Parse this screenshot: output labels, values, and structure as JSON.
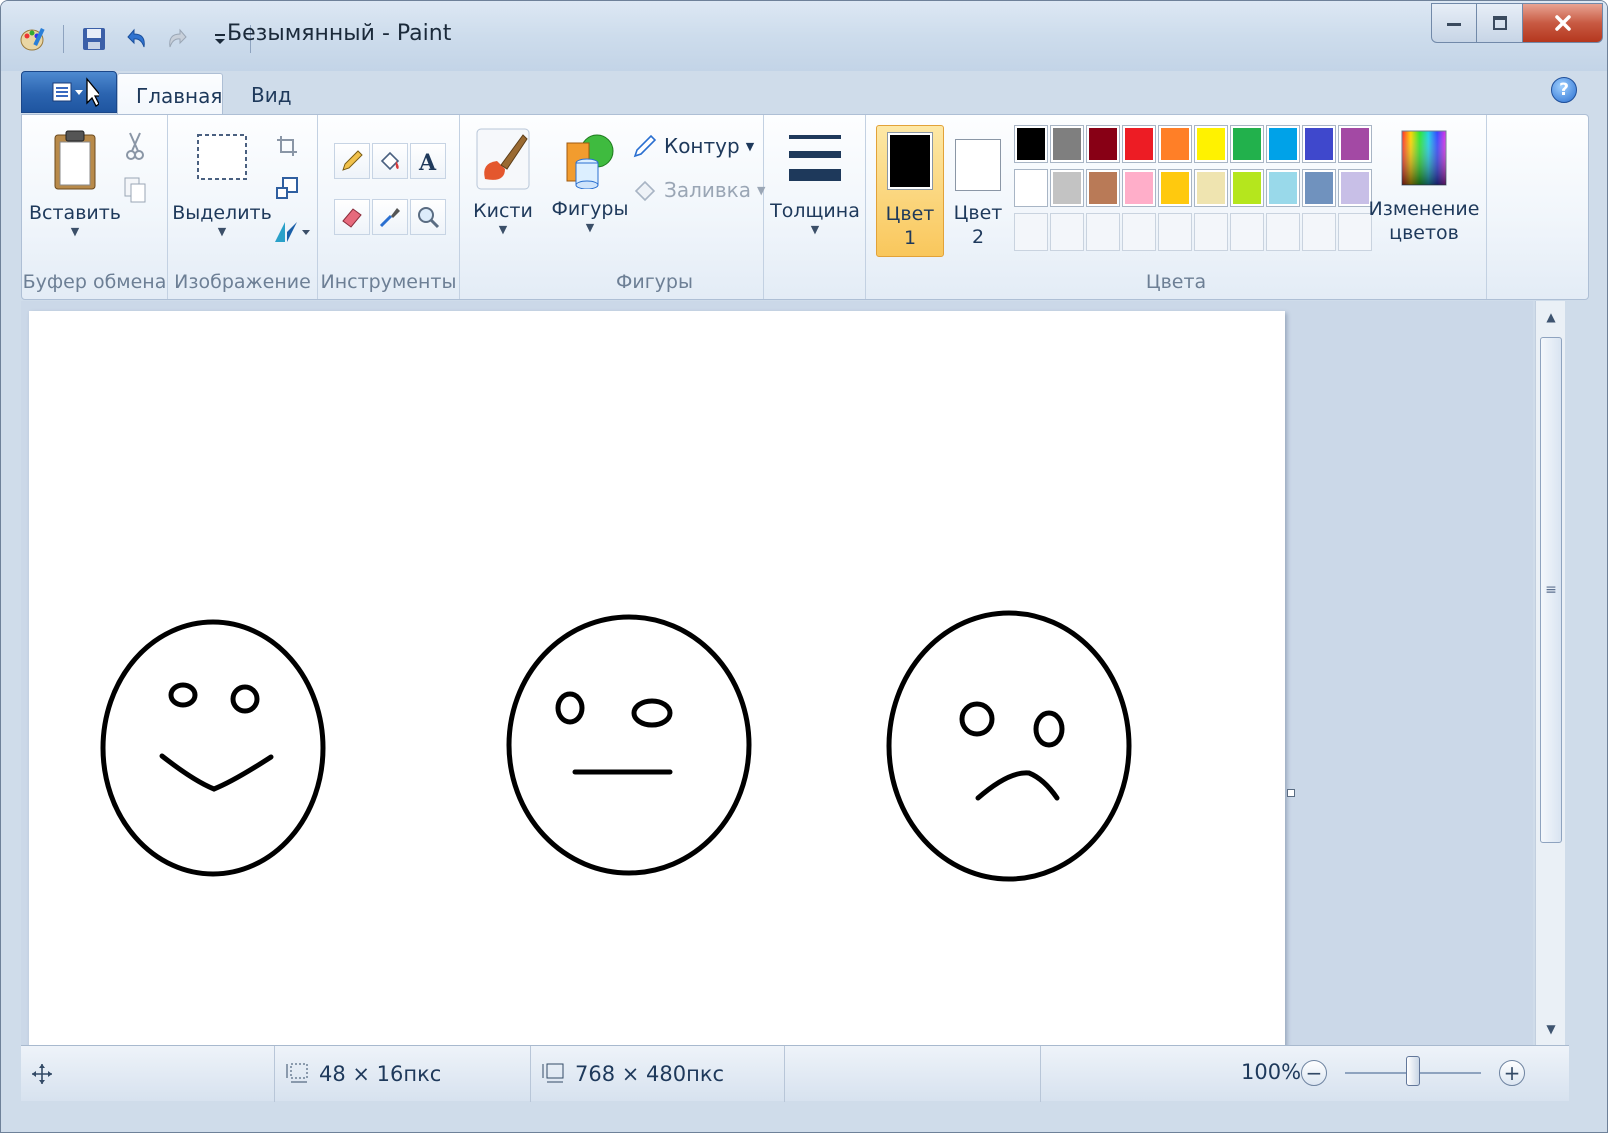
{
  "window": {
    "title": "Безымянный - Paint"
  },
  "tabs": {
    "home": "Главная",
    "view": "Вид"
  },
  "ribbon": {
    "clipboard": {
      "group_label": "Буфер обмена",
      "paste_label": "Вставить"
    },
    "image": {
      "group_label": "Изображение",
      "select_label": "Выделить"
    },
    "tools": {
      "group_label": "Инструменты"
    },
    "brushes": {
      "label": "Кисти"
    },
    "shapes": {
      "group_label": "Фигуры",
      "shapes_label": "Фигуры",
      "outline_label": "Контур",
      "fill_label": "Заливка"
    },
    "size": {
      "label": "Толщина"
    },
    "colors": {
      "group_label": "Цвета",
      "color1_label": "Цвет",
      "color1_num": "1",
      "color2_label": "Цвет",
      "color2_num": "2",
      "edit_line1": "Изменение",
      "edit_line2": "цветов",
      "color1_value": "#000000",
      "color2_value": "#ffffff",
      "palette_row1": [
        "#000000",
        "#7f7f7f",
        "#880015",
        "#ed1c24",
        "#ff7f27",
        "#fff200",
        "#22b14c",
        "#00a2e8",
        "#3f48cc",
        "#a349a4"
      ],
      "palette_row2": [
        "#ffffff",
        "#c3c3c3",
        "#b97a57",
        "#ffaec9",
        "#ffc90e",
        "#efe4b0",
        "#b5e61d",
        "#99d9ea",
        "#7092be",
        "#c8bfe7"
      ]
    }
  },
  "status": {
    "selection_size": "48 × 16пкс",
    "canvas_size": "768 × 480пкс",
    "zoom": "100%",
    "zoom_fraction": 0.5
  }
}
